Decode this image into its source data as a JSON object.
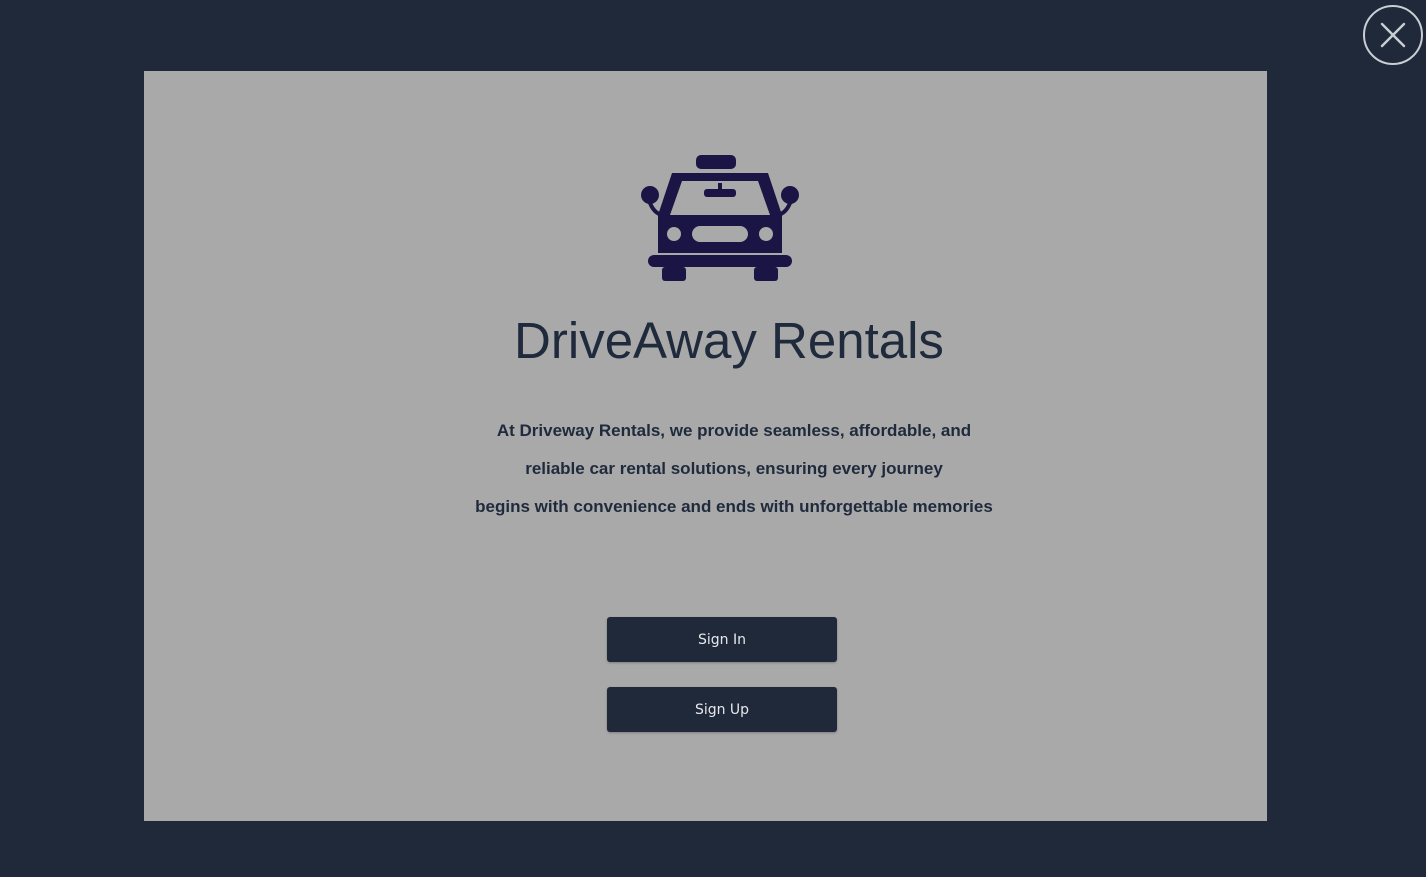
{
  "app": {
    "title": "DriveAway Rentals",
    "description_lines": [
      "At Driveway Rentals, we provide seamless, affordable, and",
      "reliable car rental solutions, ensuring every journey",
      "begins with convenience and ends with unforgettable memories"
    ],
    "logo_icon": "taxi-car-icon"
  },
  "buttons": {
    "sign_in_label": "Sign In",
    "sign_up_label": "Sign Up"
  },
  "window": {
    "close_icon": "close-icon"
  },
  "colors": {
    "background": "#202939",
    "panel": "#a9a9a9",
    "text": "#1f2a3c",
    "logo": "#1b1545",
    "button": "#202939",
    "button_text": "#e6e8ec"
  }
}
